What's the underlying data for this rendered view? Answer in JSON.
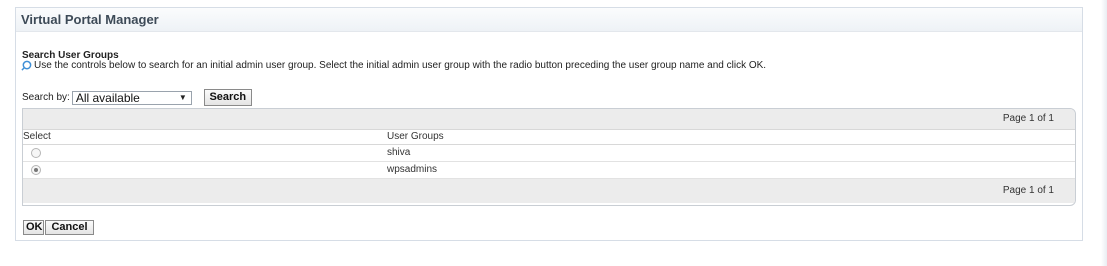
{
  "portlet": {
    "title": "Virtual Portal Manager"
  },
  "search_section": {
    "heading": "Search User Groups",
    "instructions": "Use the controls below to search for an initial admin user group. Select the initial admin user group with the radio button preceding the user group name and click OK.",
    "search_by_label": "Search by:",
    "search_by_value": "All available",
    "search_button": "Search"
  },
  "grid": {
    "pager_top": "Page 1 of 1",
    "columns": [
      "Select",
      "User Groups"
    ],
    "rows": [
      {
        "group": "shiva",
        "selected": false
      },
      {
        "group": "wpsadmins",
        "selected": true
      }
    ],
    "pager_bottom": "Page 1 of 1"
  },
  "actions": {
    "ok": "OK",
    "cancel": "Cancel"
  },
  "colors": {
    "title_text": "#3d4a57",
    "grid_bar": "#ececec",
    "border": "#c9ced4"
  }
}
